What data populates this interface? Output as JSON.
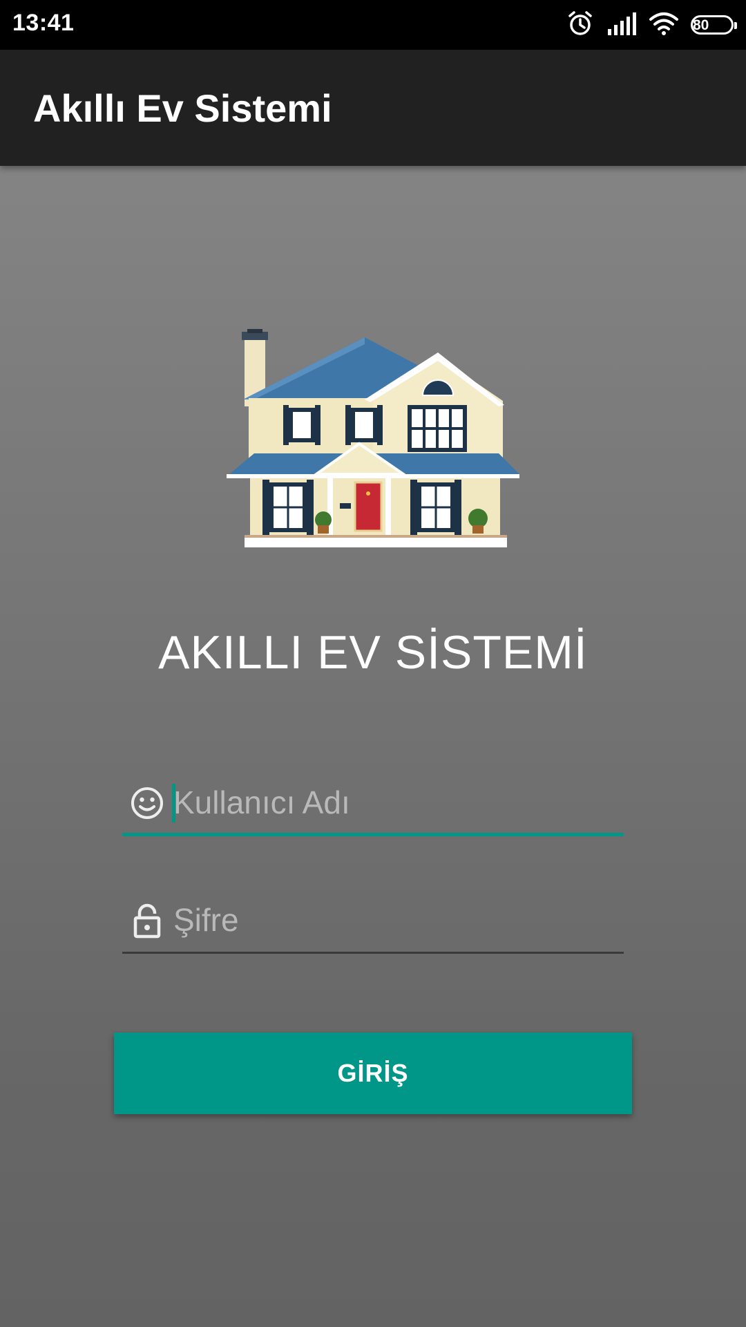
{
  "status_bar": {
    "time": "13:41",
    "battery_level": "80",
    "icons": [
      "alarm-icon",
      "signal-icon",
      "wifi-icon",
      "battery-icon"
    ]
  },
  "app_bar": {
    "title": "Akıllı Ev Sistemi"
  },
  "illustration": {
    "icon": "house-illustration"
  },
  "main": {
    "headline": "AKILLI EV SİSTEMİ",
    "username": {
      "value": "",
      "placeholder": "Kullanıcı Adı",
      "icon": "smiley-face-icon",
      "focused": true
    },
    "password": {
      "value": "",
      "placeholder": "Şifre",
      "icon": "lock-icon",
      "focused": false
    },
    "login_button_label": "GİRİŞ"
  },
  "colors": {
    "accent": "#009688",
    "app_bar": "#212121",
    "status_bar": "#000000",
    "background_top": "#898989",
    "background_bottom": "#636363"
  }
}
